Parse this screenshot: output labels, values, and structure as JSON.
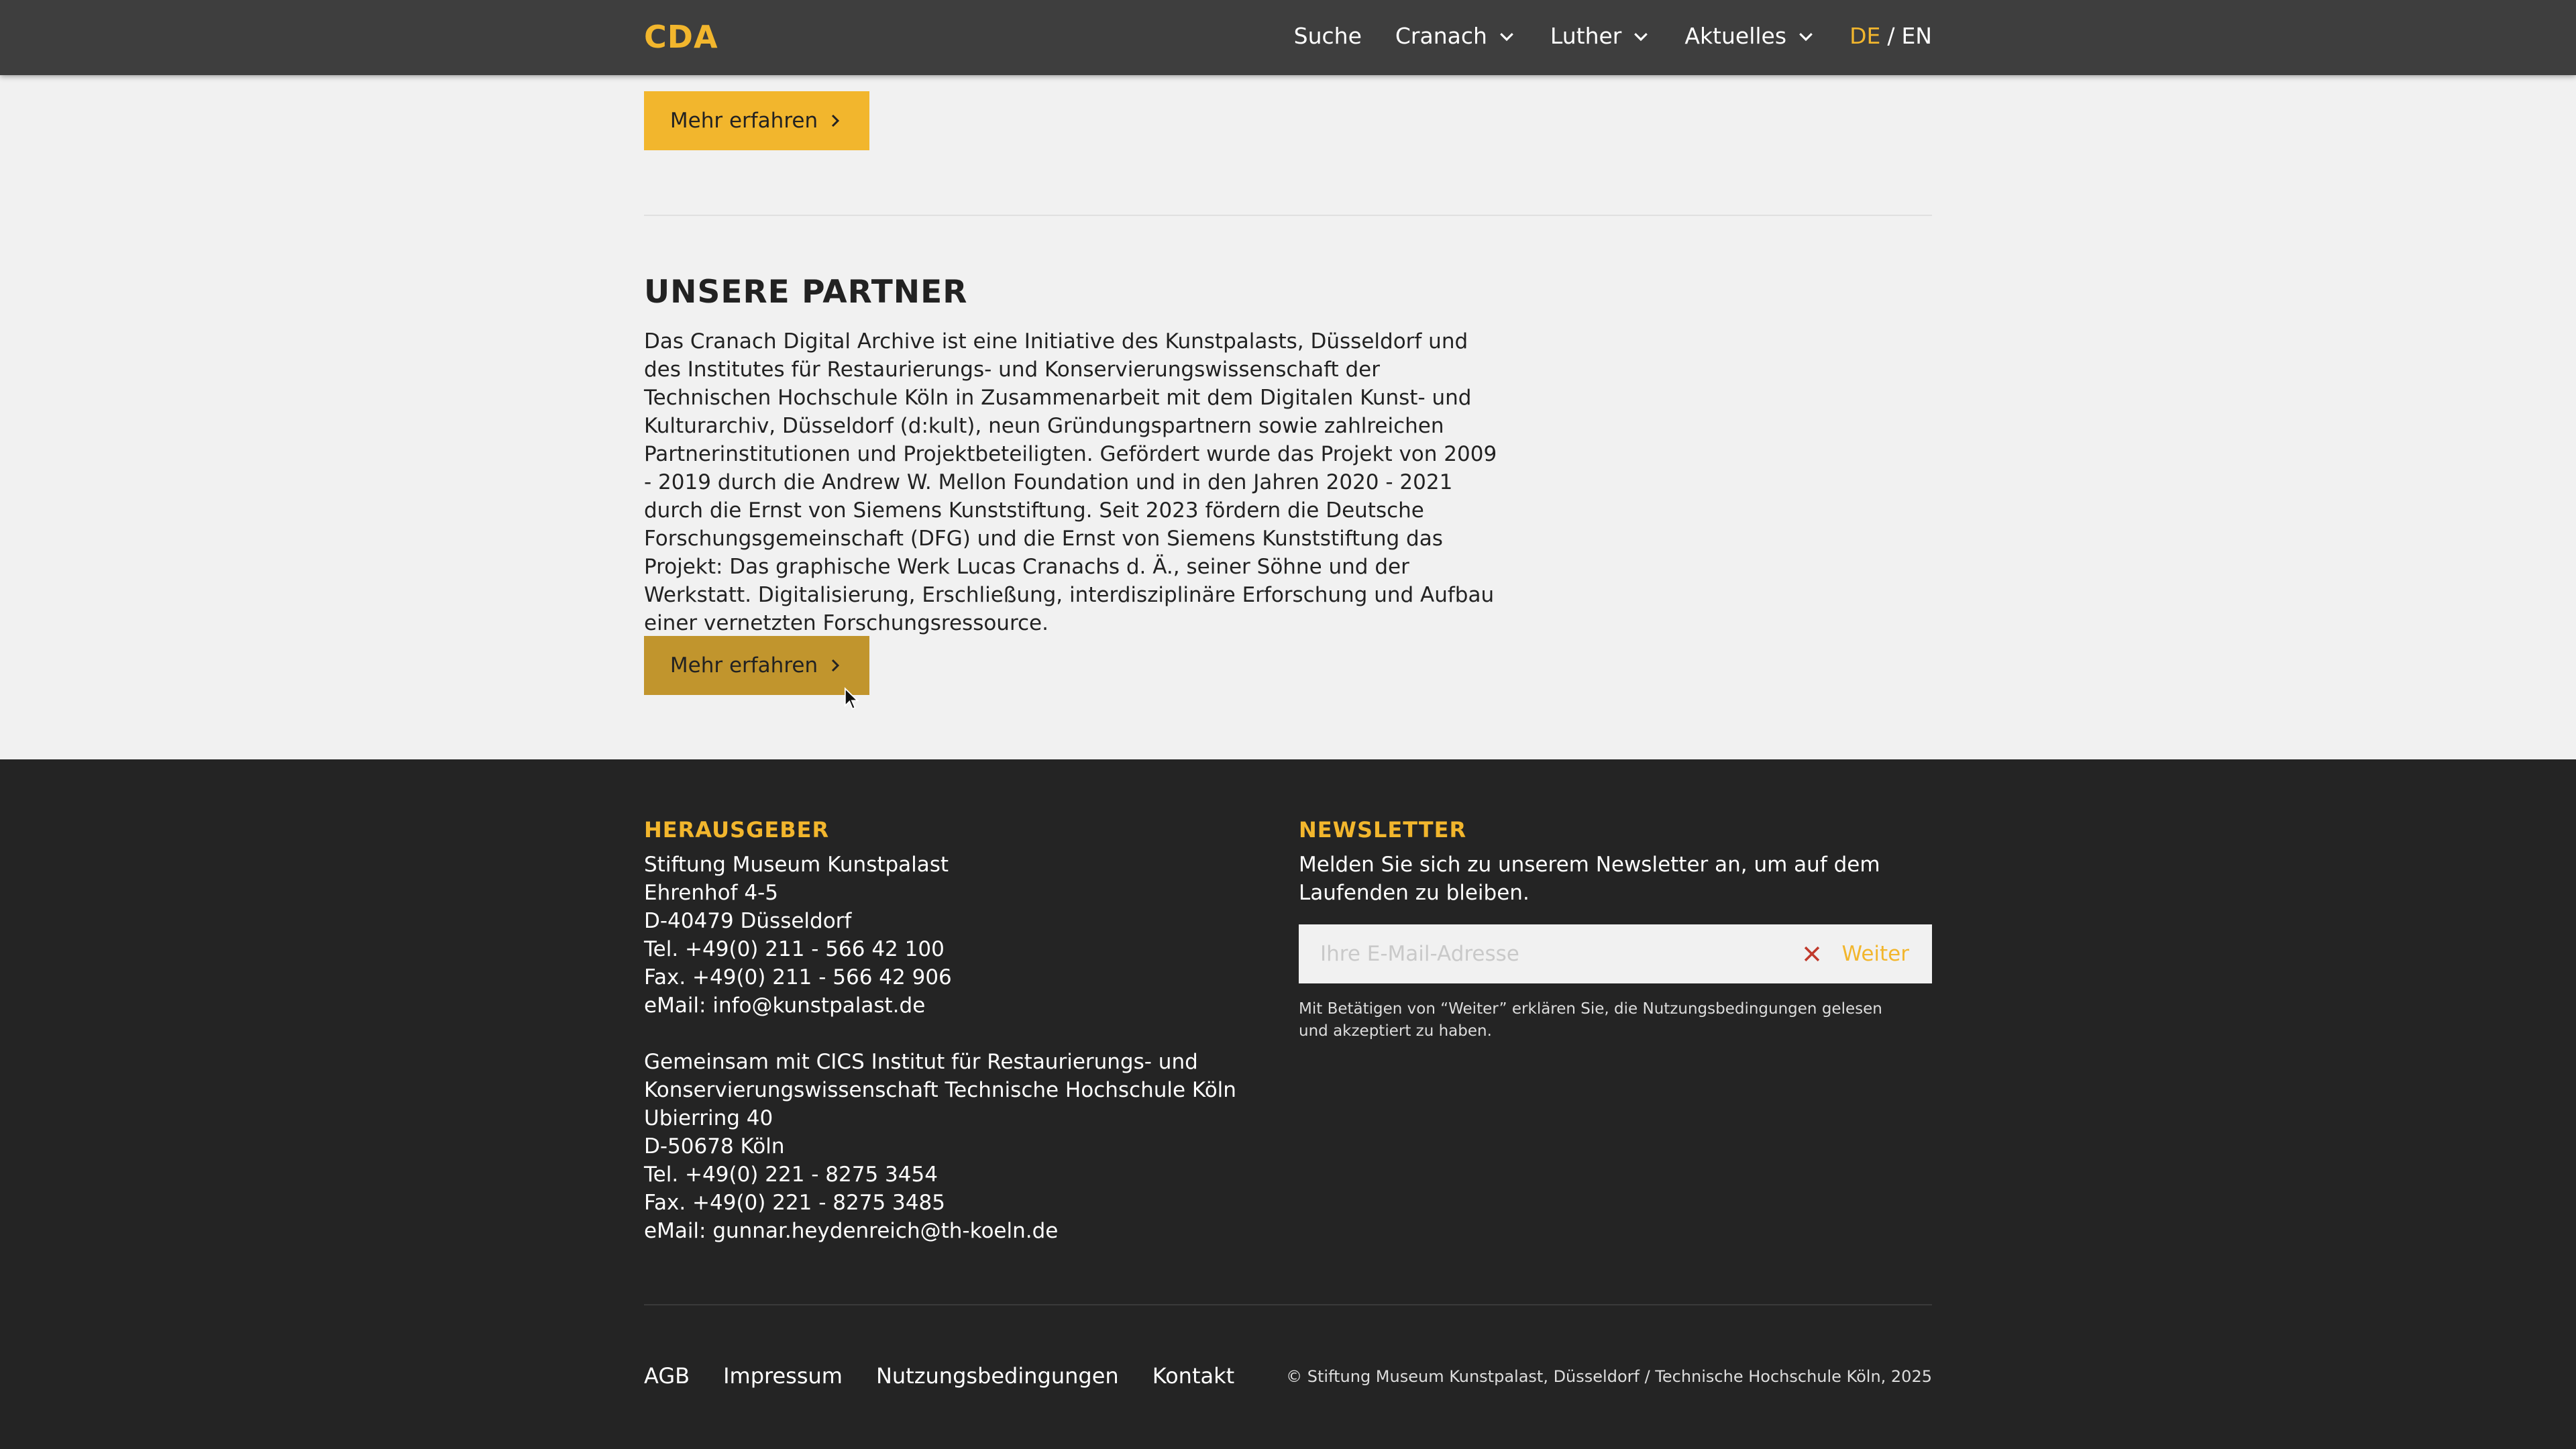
{
  "header": {
    "logo": "CDA",
    "nav": {
      "search": "Suche",
      "cranach": "Cranach",
      "luther": "Luther",
      "news": "Aktuelles"
    },
    "lang": {
      "de": "DE",
      "sep": "/",
      "en": "EN"
    }
  },
  "main": {
    "more_button_1": "Mehr erfahren",
    "partners_title": "UNSERE PARTNER",
    "partners_text": "Das Cranach Digital Archive ist eine Initiative des Kunstpalasts, Düsseldorf und des Institutes für Restaurierungs- und Konservierungswissenschaft der Technischen Hochschule Köln in Zusammenarbeit mit dem Digitalen Kunst- und Kulturarchiv, Düsseldorf (d:kult), neun Gründungspartnern sowie zahlreichen Partnerinstitutionen und Projektbeteiligten. Gefördert wurde das Projekt von 2009 - 2019 durch die Andrew W. Mellon Foundation und in den Jahren 2020 - 2021 durch die Ernst von Siemens Kunststiftung. Seit 2023 fördern die Deutsche Forschungsgemeinschaft (DFG) und die Ernst von Siemens Kunststiftung das Projekt: Das graphische Werk Lucas Cranachs d. Ä., seiner Söhne und der Werkstatt. Digitalisierung, Erschließung, interdisziplinäre Erforschung und Aufbau einer vernetzten Forschungsressource.",
    "more_button_2": "Mehr erfahren"
  },
  "footer": {
    "publisher_heading": "HERAUSGEBER",
    "publisher": [
      "Stiftung Museum Kunstpalast",
      "Ehrenhof 4-5",
      "D-40479 Düsseldorf",
      "Tel. +49(0) 211 - 566 42 100",
      "Fax. +49(0) 211 - 566 42 906",
      "eMail: info@kunstpalast.de"
    ],
    "partner": [
      "Gemeinsam mit CICS Institut für Restaurierungs- und",
      "Konservierungswissenschaft Technische Hochschule Köln",
      "Ubierring 40",
      "D-50678 Köln",
      "Tel. +49(0) 221 - 8275 3454",
      "Fax. +49(0) 221 - 8275 3485",
      "eMail: gunnar.heydenreich@th-koeln.de"
    ],
    "newsletter_heading": "NEWSLETTER",
    "newsletter_text": "Melden Sie sich zu unserem Newsletter an, um auf dem Laufenden zu bleiben.",
    "email_placeholder": "Ihre E-Mail-Adresse",
    "submit_label": "Weiter",
    "note": "Mit Betätigen von “Weiter” erklären Sie, die Nutzungsbedingungen gelesen und akzeptiert zu haben.",
    "links": {
      "agb": "AGB",
      "imprint": "Impressum",
      "terms": "Nutzungsbedingungen",
      "contact": "Kontakt"
    },
    "copyright": "© Stiftung Museum Kunstpalast, Düsseldorf / Technische Hochschule Köln, 2025"
  },
  "colors": {
    "accent": "#f2b62d",
    "accent_hover": "#c1952d",
    "header_bg": "#3e3e3e",
    "footer_bg": "#242424",
    "page_bg": "#f1f1f1",
    "clear_icon": "#c0392b"
  }
}
